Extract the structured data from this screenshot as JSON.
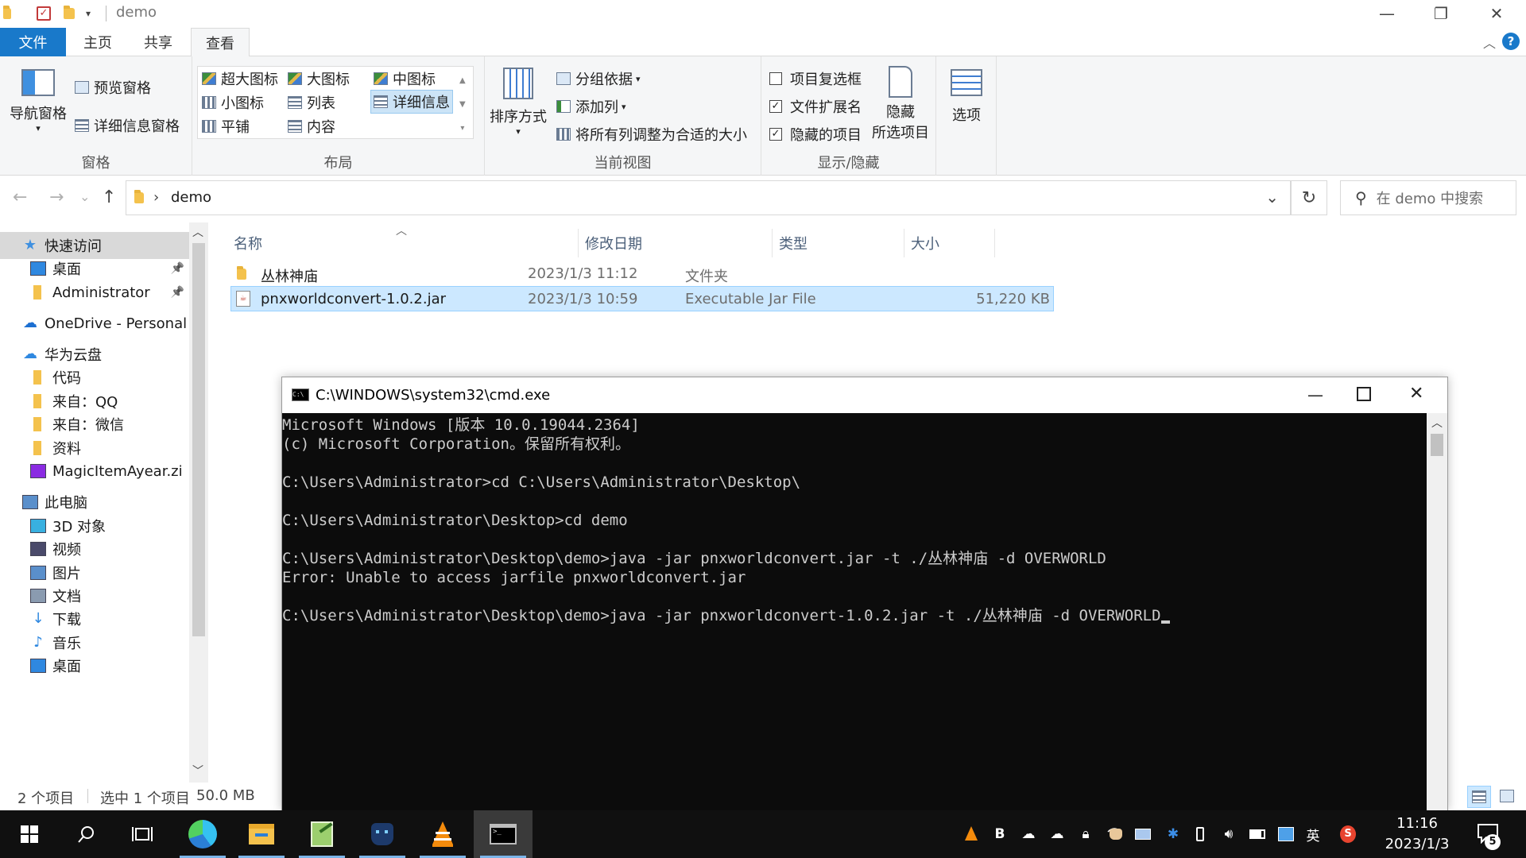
{
  "window": {
    "title": "demo",
    "minimize": "—",
    "restore": "❐",
    "close": "✕"
  },
  "ribbon_tabs": {
    "file": "文件",
    "home": "主页",
    "share": "共享",
    "view": "查看",
    "help": "?",
    "collapse": "︿"
  },
  "ribbon": {
    "panes": {
      "nav_pane": "导航窗格",
      "preview_pane": "预览窗格",
      "details_pane": "详细信息窗格",
      "label": "窗格"
    },
    "layout": {
      "extra_large": "超大图标",
      "large": "大图标",
      "medium": "中图标",
      "small": "小图标",
      "list": "列表",
      "details": "详细信息",
      "tiles": "平铺",
      "content": "内容",
      "label": "布局"
    },
    "current_view": {
      "sort_by": "排序方式",
      "group_by": "分组依据",
      "add_columns": "添加列",
      "size_all_columns": "将所有列调整为合适的大小",
      "label": "当前视图"
    },
    "show_hide": {
      "item_checkboxes": "项目复选框",
      "item_checkboxes_checked": false,
      "file_extensions": "文件扩展名",
      "file_extensions_checked": true,
      "hidden_items": "隐藏的项目",
      "hidden_items_checked": true,
      "hide_selected_1": "隐藏",
      "hide_selected_2": "所选项目",
      "label": "显示/隐藏"
    },
    "options": "选项"
  },
  "address": {
    "back": "←",
    "forward": "→",
    "recent": "⌄",
    "up": "↑",
    "crumb": "demo",
    "crumb_sep": "›",
    "dropdown": "⌄",
    "refresh": "↻",
    "search_icon": "⚲",
    "search_placeholder": "在 demo 中搜索"
  },
  "sidebar": {
    "scroll_up": "︿",
    "scroll_down": "﹀",
    "items": [
      {
        "label": "快速访问",
        "icon": "star-icon"
      },
      {
        "label": "桌面",
        "icon": "desktop-icon"
      },
      {
        "label": "Administrator",
        "icon": "folder-icon"
      },
      {
        "label": "OneDrive - Personal",
        "icon": "cloud-icon"
      },
      {
        "label": "华为云盘",
        "icon": "huawei-cloud-icon"
      },
      {
        "label": "代码",
        "icon": "folder-icon"
      },
      {
        "label": "来自：QQ",
        "icon": "folder-icon"
      },
      {
        "label": "来自：微信",
        "icon": "folder-icon"
      },
      {
        "label": "资料",
        "icon": "folder-icon"
      },
      {
        "label": "MagicItemAyear.zi",
        "icon": "archive-icon"
      },
      {
        "label": "此电脑",
        "icon": "computer-icon"
      },
      {
        "label": "3D 对象",
        "icon": "cube-icon"
      },
      {
        "label": "视频",
        "icon": "video-icon"
      },
      {
        "label": "图片",
        "icon": "picture-icon"
      },
      {
        "label": "文档",
        "icon": "document-icon"
      },
      {
        "label": "下载",
        "icon": "download-icon"
      },
      {
        "label": "音乐",
        "icon": "music-icon"
      },
      {
        "label": "桌面",
        "icon": "desktop-icon"
      }
    ],
    "pin": "📌"
  },
  "filelist": {
    "columns": {
      "name": "名称",
      "modified": "修改日期",
      "type": "类型",
      "size": "大小"
    },
    "sort_arrow": "︿",
    "rows": [
      {
        "name": "丛林神庙",
        "modified": "2023/1/3 11:12",
        "type": "文件夹",
        "size": ""
      },
      {
        "name": "pnxworldconvert-1.0.2.jar",
        "modified": "2023/1/3 10:59",
        "type": "Executable Jar File",
        "size": "51,220 KB"
      }
    ]
  },
  "status": {
    "count": "2 个项目",
    "selection": "选中 1 个项目",
    "selection_size": "50.0 MB"
  },
  "cmd": {
    "title": "C:\\WINDOWS\\system32\\cmd.exe",
    "icon_text": "C:\\",
    "lines": [
      "Microsoft Windows [版本 10.0.19044.2364]",
      "(c) Microsoft Corporation。保留所有权利。",
      "",
      "C:\\Users\\Administrator>cd C:\\Users\\Administrator\\Desktop\\",
      "",
      "C:\\Users\\Administrator\\Desktop>cd demo",
      "",
      "C:\\Users\\Administrator\\Desktop\\demo>java -jar pnxworldconvert.jar -t ./丛林神庙 -d OVERWORLD",
      "Error: Unable to access jarfile pnxworldconvert.jar",
      "",
      "C:\\Users\\Administrator\\Desktop\\demo>java -jar pnxworldconvert-1.0.2.jar -t ./丛林神庙 -d OVERWORLD"
    ],
    "scroll_up": "︿"
  },
  "taskbar": {
    "clock_time": "11:16",
    "clock_date": "2023/1/3",
    "ime": "英",
    "notification_count": "5",
    "tray_b": "B"
  }
}
